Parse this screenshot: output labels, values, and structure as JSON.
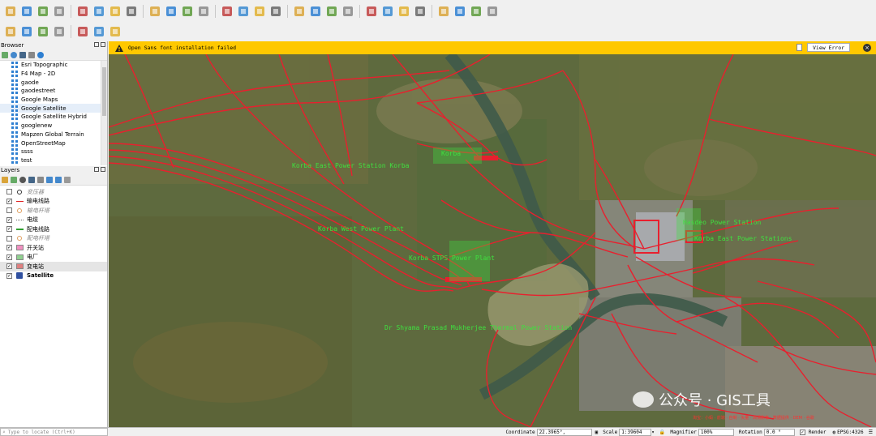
{
  "toolbar": {
    "row1_icons": [
      "new-project-icon",
      "open-project-icon",
      "save-project-icon",
      "print-icon",
      "style-manager-icon",
      "vector-add-icon",
      "raster-add-icon",
      "digitize-icon",
      "pan-icon",
      "zoom-icon",
      "identify-icon",
      "select-icon",
      "measure-icon",
      "attribute-table-icon",
      "plugin-icon",
      "python-icon"
    ],
    "row2_icons": [
      "node-tool-icon",
      "pin-icon",
      "zoom-in-icon",
      "zoom-out-icon",
      "zoom-full-icon",
      "globe-icon",
      "pencil-icon"
    ]
  },
  "browser": {
    "title": "Browser",
    "items": [
      {
        "label": "Esri Topographic"
      },
      {
        "label": "F4 Map - 2D"
      },
      {
        "label": "gaode"
      },
      {
        "label": "gaodestreet"
      },
      {
        "label": "Google Maps"
      },
      {
        "label": "Google Satellite",
        "selected": true
      },
      {
        "label": "Google Satellite Hybrid"
      },
      {
        "label": "googlenew"
      },
      {
        "label": "Mapzen Global Terrain"
      },
      {
        "label": "OpenStreetMap"
      },
      {
        "label": "ssss"
      },
      {
        "label": "test"
      }
    ]
  },
  "layers": {
    "title": "Layers",
    "items": [
      {
        "label": "变压器",
        "checked": false,
        "style": "grey",
        "symbol": "circle",
        "color": "#333333"
      },
      {
        "label": "输电线路",
        "checked": true,
        "style": "normal",
        "symbol": "line",
        "color": "#e02020"
      },
      {
        "label": "输电杆塔",
        "checked": false,
        "style": "grey",
        "symbol": "circle",
        "color": "#e0a060"
      },
      {
        "label": "电缆",
        "checked": true,
        "style": "normal",
        "symbol": "dashed",
        "color": "#666666"
      },
      {
        "label": "配电线路",
        "checked": true,
        "style": "normal",
        "symbol": "line",
        "color": "#30a030"
      },
      {
        "label": "配电杆塔",
        "checked": false,
        "style": "grey",
        "symbol": "circle",
        "color": "#e0a060"
      },
      {
        "label": "开关站",
        "checked": true,
        "style": "normal",
        "symbol": "fill",
        "color": "#f090c0"
      },
      {
        "label": "电厂",
        "checked": true,
        "style": "normal",
        "symbol": "fill",
        "color": "#90d090"
      },
      {
        "label": "变电站",
        "checked": true,
        "style": "selected",
        "symbol": "fill",
        "color": "#e08080"
      },
      {
        "label": "Satellite",
        "checked": true,
        "style": "bold",
        "symbol": "raster",
        "color": "#3050a0"
      }
    ]
  },
  "messagebar": {
    "text": "Open Sans font installation failed",
    "button": "View Error",
    "color": "#ffc800"
  },
  "map": {
    "labels": [
      {
        "text": "Korba"
      },
      {
        "text": "Korba East Power Station Korba"
      },
      {
        "text": "Korba West Power Plant"
      },
      {
        "text": "Korba STPS Power Plant"
      },
      {
        "text": "Hasdeo Power Station"
      },
      {
        "text": "Korba East Power Stations"
      },
      {
        "text": "Dr Shyama Prasad Mukherjee Thermal Power Station"
      }
    ],
    "line_color": "#e8202e",
    "label_color": "#3fe03f"
  },
  "watermark": {
    "text": "公众号 · GIS工具",
    "sub": "淘宝：小蚂 · 前端 · 自制 · 矢量 · 高清影像 · 数据提供 · DEM · 谷歌"
  },
  "status": {
    "locate_placeholder": "Type to locate (Ctrl+K)",
    "coordinate_label": "Coordinate",
    "coordinate": "22.3965°, 82.6771°",
    "scale_label": "Scale",
    "scale": "1:39604",
    "magnifier_label": "Magnifier",
    "magnifier": "100%",
    "rotation_label": "Rotation",
    "rotation": "0.0 °",
    "render_label": "Render",
    "crs": "EPSG:4326"
  }
}
